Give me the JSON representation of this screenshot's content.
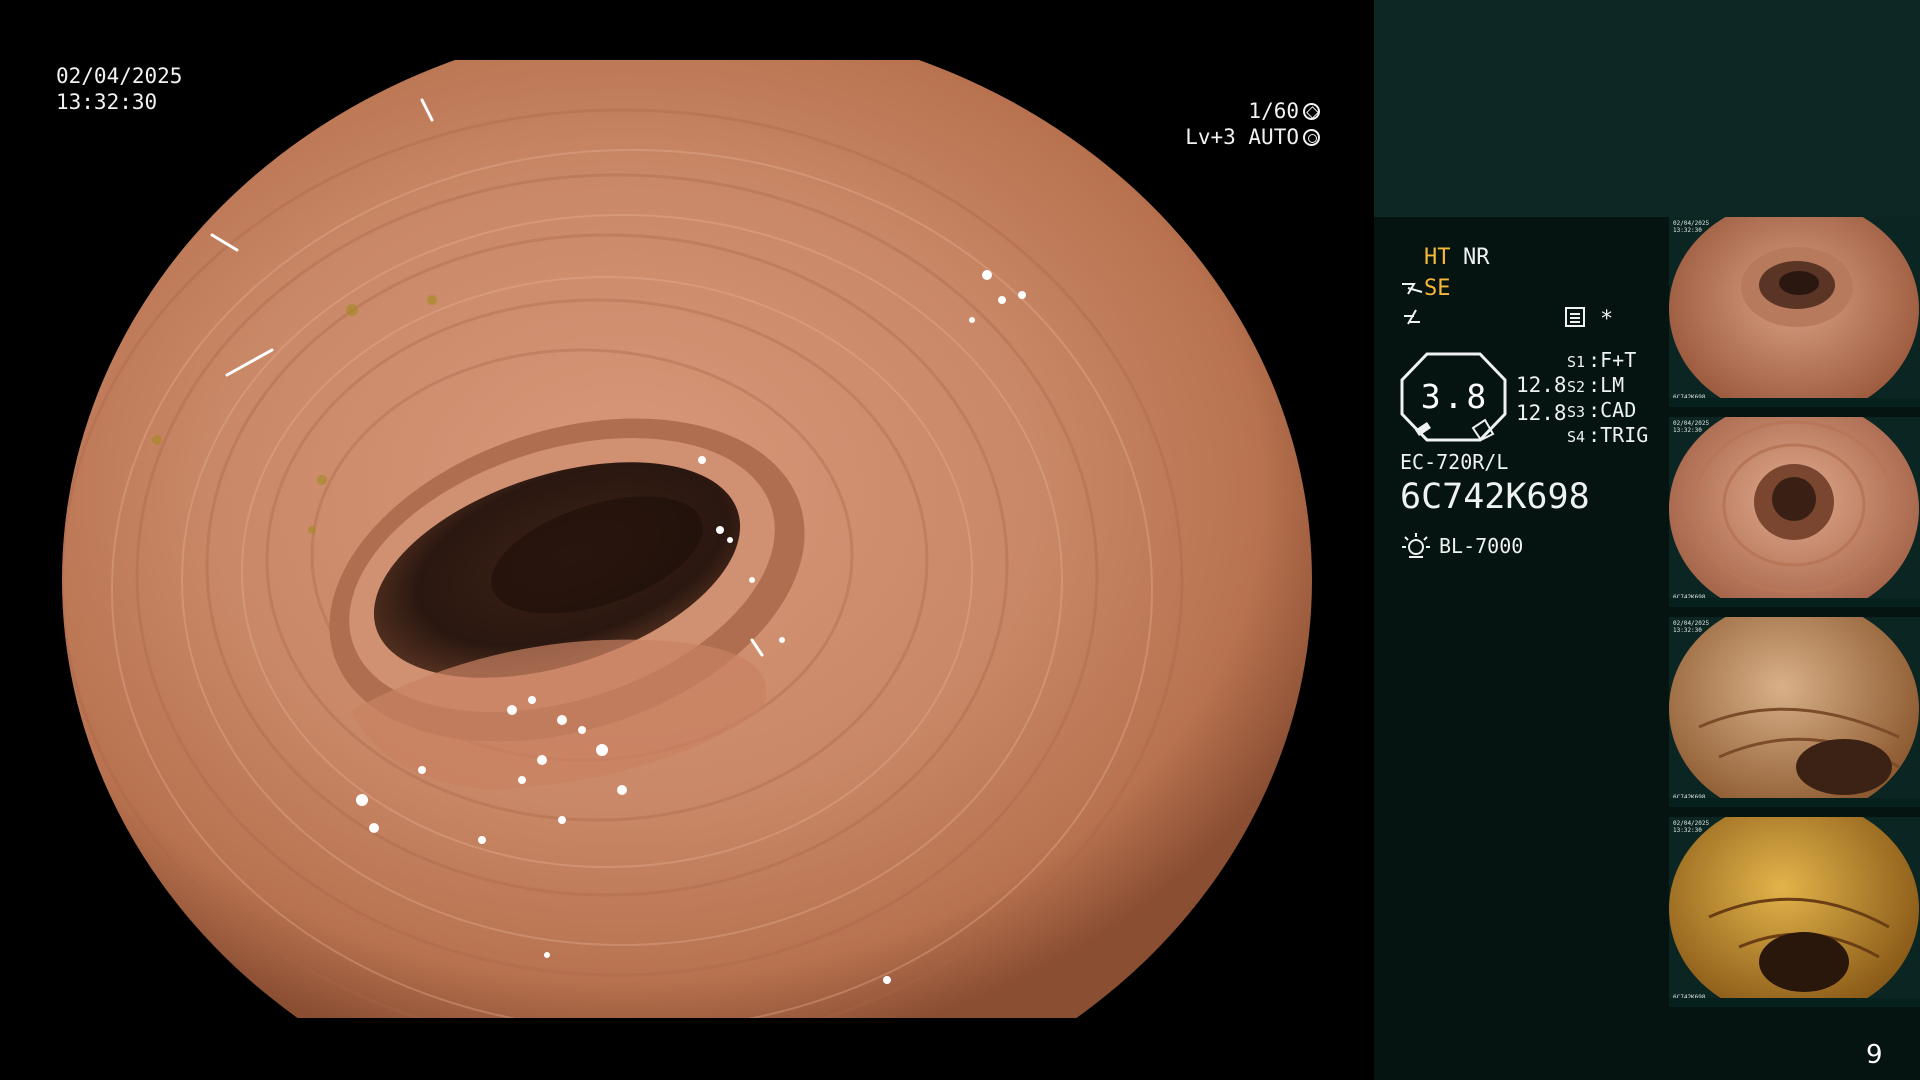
{
  "overlay": {
    "date": "02/04/2025",
    "time": "13:32:30",
    "shutter": "1/60",
    "level_auto": "Lv+3 AUTO"
  },
  "panel": {
    "ht": "HT",
    "nr": "NR",
    "se": "SE",
    "star": "*",
    "gauge_value": "3.8",
    "value_1": "12.8",
    "value_2": "12.8",
    "switches": [
      {
        "key": "S1",
        "value": "F+T"
      },
      {
        "key": "S2",
        "value": "LM"
      },
      {
        "key": "S3",
        "value": "CAD"
      },
      {
        "key": "S4",
        "value": "TRIG"
      }
    ],
    "scope_model": "EC-720R/L",
    "scope_serial": "6C742K698",
    "light_source": "BL-7000",
    "page_number": "9"
  },
  "thumbnails": [
    {
      "date": "02/04/2025",
      "time": "13:32:30",
      "serial": "6C742K698"
    },
    {
      "date": "02/04/2025",
      "time": "13:32:30",
      "serial": "6C742K698"
    },
    {
      "date": "02/04/2025",
      "time": "13:32:30",
      "serial": "6C742K698"
    },
    {
      "date": "02/04/2025",
      "time": "13:32:30",
      "serial": "6C742K698"
    }
  ],
  "colors": {
    "mucosa": "#c98867",
    "lumen": "#2a1710",
    "panel_top": "#0d2824",
    "panel_bottom": "#051311",
    "indicator_amber": "#f6b83a"
  },
  "icons": [
    "se-icon",
    "wave-icon",
    "memo-icon",
    "exposure-mode-icon",
    "aperture-icon",
    "light-source-icon"
  ]
}
